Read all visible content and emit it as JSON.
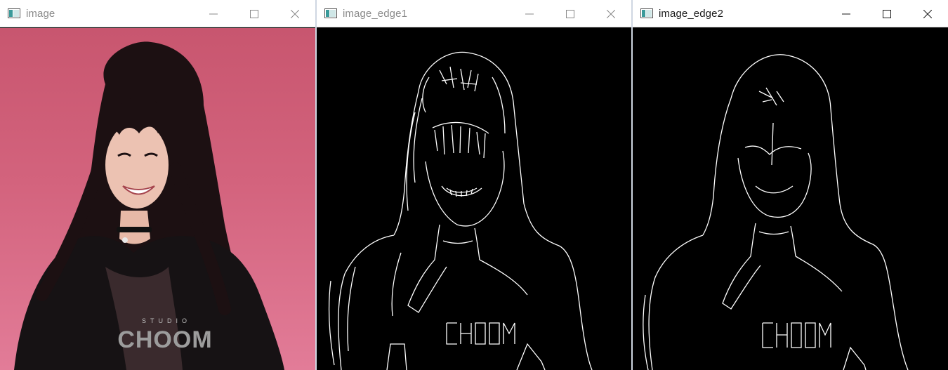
{
  "windows": [
    {
      "title": "image"
    },
    {
      "title": "image_edge1"
    },
    {
      "title": "image_edge2"
    }
  ],
  "watermark": {
    "small": "STUDIO",
    "main": "CHOOM"
  },
  "colors": {
    "titlebar": "#ffffff",
    "title_inactive": "#8a8a8a",
    "title_active": "#1a1a1a",
    "photo_bg": "#d3637d",
    "edge_bg": "#000000",
    "edge_line": "#ffffff"
  }
}
